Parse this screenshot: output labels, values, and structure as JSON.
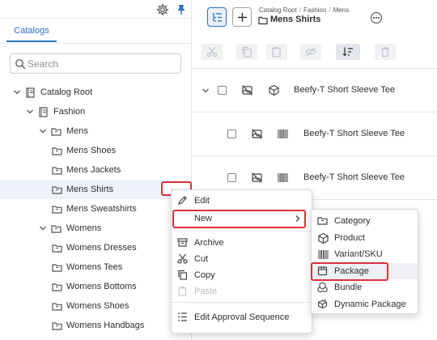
{
  "header_icons": {
    "settings": "gear-icon",
    "pin": "pin-icon"
  },
  "tabs": {
    "catalogs": "Catalogs"
  },
  "search": {
    "placeholder": "Search"
  },
  "tree": {
    "items": [
      {
        "label": "Catalog Root",
        "icon": "catalog-book-icon",
        "expanded": true
      },
      {
        "label": "Fashion",
        "icon": "catalog-book-icon",
        "expanded": true
      },
      {
        "label": "Mens",
        "icon": "category-folder-icon",
        "expanded": true
      },
      {
        "label": "Mens Shoes",
        "icon": "category-folder-icon"
      },
      {
        "label": "Mens Jackets",
        "icon": "category-folder-icon"
      },
      {
        "label": "Mens Shirts",
        "icon": "category-folder-icon",
        "selected": true
      },
      {
        "label": "Mens Sweatshirts",
        "icon": "category-folder-icon"
      },
      {
        "label": "Womens",
        "icon": "category-folder-icon",
        "expanded": true
      },
      {
        "label": "Womens Dresses",
        "icon": "category-folder-icon"
      },
      {
        "label": "Womens Tees",
        "icon": "category-folder-icon"
      },
      {
        "label": "Womens Bottoms",
        "icon": "category-folder-icon"
      },
      {
        "label": "Womens Shoes",
        "icon": "category-folder-icon"
      },
      {
        "label": "Womens Handbags",
        "icon": "category-folder-icon"
      }
    ]
  },
  "main": {
    "breadcrumb": [
      "Catalog Root",
      "Fashion",
      "Mens"
    ],
    "breadcrumb_separator": "/",
    "title": "Mens Shirts",
    "rows": [
      {
        "label": "Beefy-T Short Sleeve Tee",
        "type_icon": "product-box-icon"
      },
      {
        "label": "Beefy-T Short Sleeve Tee",
        "type_icon": "barcode-icon"
      },
      {
        "label": "Beefy-T Short Sleeve Tee",
        "type_icon": "barcode-icon"
      }
    ]
  },
  "context_menu": {
    "items": [
      {
        "label": "Edit",
        "icon": "pencil-icon"
      },
      {
        "label": "New",
        "icon": "",
        "submenu": true
      },
      {
        "label": "Archive",
        "icon": "archive-icon"
      },
      {
        "label": "Cut",
        "icon": "scissors-icon"
      },
      {
        "label": "Copy",
        "icon": "copy-icon"
      },
      {
        "label": "Paste",
        "icon": "paste-icon",
        "disabled": true
      },
      {
        "label": "Edit Approval Sequence",
        "icon": "list-icon"
      }
    ]
  },
  "submenu": {
    "items": [
      {
        "label": "Category",
        "icon": "category-folder-icon"
      },
      {
        "label": "Product",
        "icon": "product-box-icon"
      },
      {
        "label": "Variant/SKU",
        "icon": "barcode-icon"
      },
      {
        "label": "Package",
        "icon": "package-icon",
        "highlighted": true
      },
      {
        "label": "Bundle",
        "icon": "bundle-icon"
      },
      {
        "label": "Dynamic Package",
        "icon": "dynamic-package-icon"
      }
    ]
  },
  "colors": {
    "accent": "#2a6fc4",
    "highlight_border": "#d9323b",
    "selected_row": "#eef3fb"
  }
}
